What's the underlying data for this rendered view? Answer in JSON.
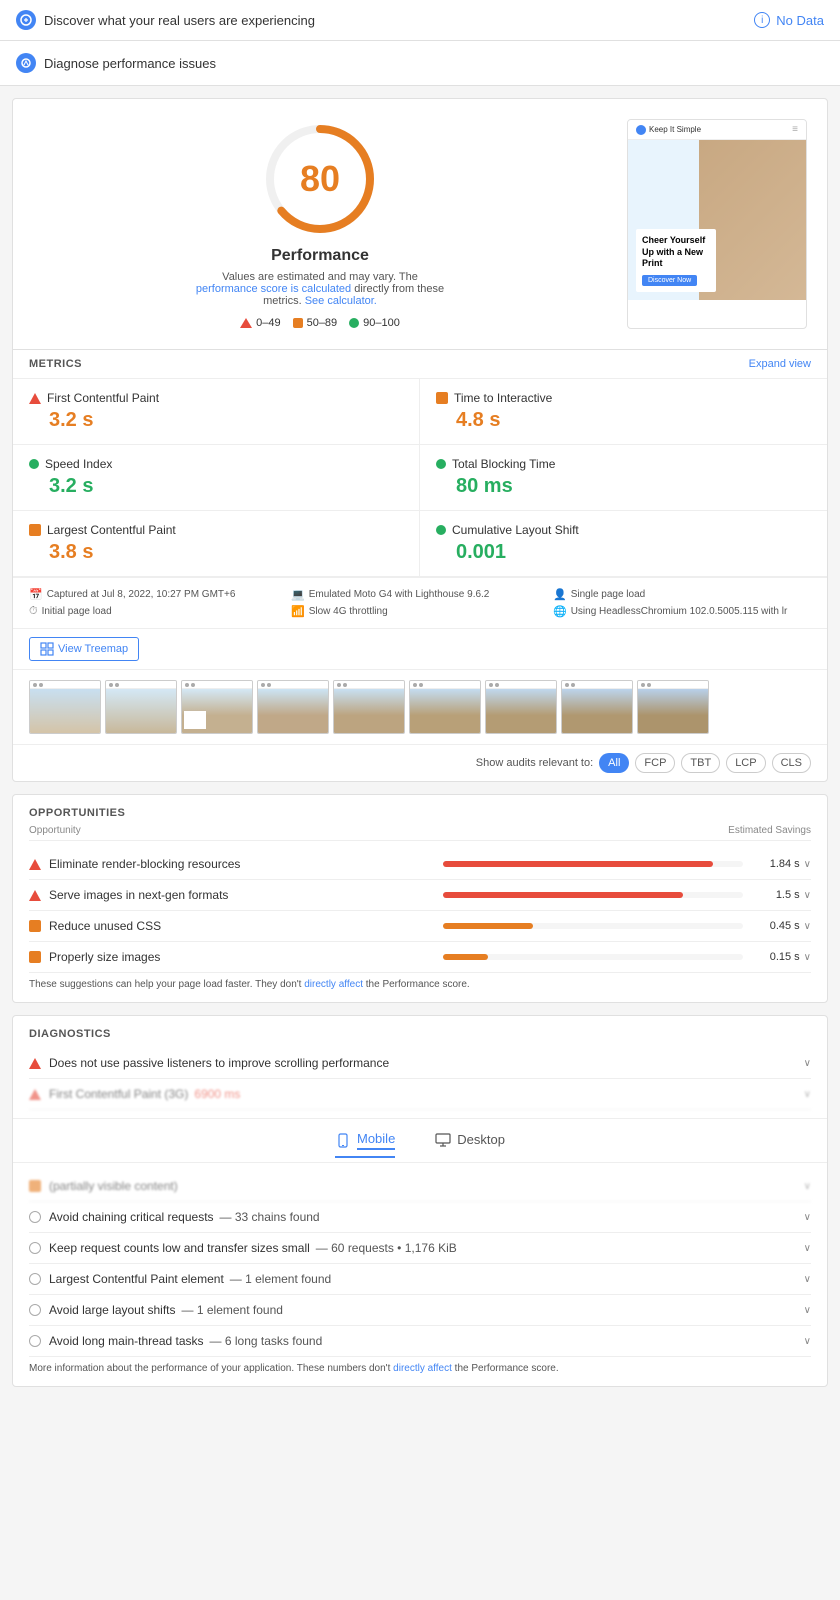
{
  "topBar": {
    "title": "Discover what your real users are experiencing",
    "noDataLabel": "No Data"
  },
  "sectionHeader": {
    "title": "Diagnose performance issues"
  },
  "score": {
    "value": "80",
    "label": "Performance",
    "description": "Values are estimated and may vary. The",
    "descriptionLink": "performance score is calculated",
    "descriptionMid": "directly from these metrics.",
    "calculatorLink": "See calculator.",
    "legend": [
      {
        "label": "0–49",
        "type": "triangle",
        "color": "#e74c3c"
      },
      {
        "label": "50–89",
        "type": "square",
        "color": "#e67e22"
      },
      {
        "label": "90–100",
        "type": "circle",
        "color": "#27ae60"
      }
    ]
  },
  "preview": {
    "siteName": "Keep It Simple",
    "headline": "Cheer Yourself Up with a New Print",
    "buttonLabel": "Discover Now"
  },
  "metrics": {
    "sectionLabel": "METRICS",
    "expandLabel": "Expand view",
    "items": [
      {
        "name": "First Contentful Paint",
        "value": "3.2 s",
        "color": "orange",
        "indicator": "red"
      },
      {
        "name": "Time to Interactive",
        "value": "4.8 s",
        "color": "orange",
        "indicator": "orange-sq"
      },
      {
        "name": "Speed Index",
        "value": "3.2 s",
        "color": "green",
        "indicator": "green-circle"
      },
      {
        "name": "Total Blocking Time",
        "value": "80 ms",
        "color": "green",
        "indicator": "green-circle"
      },
      {
        "name": "Largest Contentful Paint",
        "value": "3.8 s",
        "color": "orange",
        "indicator": "orange-sq"
      },
      {
        "name": "Cumulative Layout Shift",
        "value": "0.001",
        "color": "green",
        "indicator": "green-circle"
      }
    ]
  },
  "infoBar": [
    {
      "icon": "📅",
      "text": "Captured at Jul 8, 2022, 10:27 PM GMT+6"
    },
    {
      "icon": "💻",
      "text": "Emulated Moto G4 with Lighthouse 9.6.2"
    },
    {
      "icon": "👤",
      "text": "Single page load"
    },
    {
      "icon": "⏱",
      "text": "Initial page load"
    },
    {
      "icon": "📶",
      "text": "Slow 4G throttling"
    },
    {
      "icon": "🌐",
      "text": "Using HeadlessChromium 102.0.5005.115 with lr"
    }
  ],
  "treemapBtn": "View Treemap",
  "filmstrip": {
    "frames": 9
  },
  "auditFilters": {
    "label": "Show audits relevant to:",
    "buttons": [
      {
        "label": "All",
        "active": true
      },
      {
        "label": "FCP",
        "active": false
      },
      {
        "label": "TBT",
        "active": false
      },
      {
        "label": "LCP",
        "active": false
      },
      {
        "label": "CLS",
        "active": false
      }
    ]
  },
  "opportunities": {
    "sectionLabel": "OPPORTUNITIES",
    "opportunityHeader": "Opportunity",
    "savingsHeader": "Estimated Savings",
    "items": [
      {
        "name": "Eliminate render-blocking resources",
        "indicator": "red",
        "barWidth": "90%",
        "barColor": "red",
        "savings": "1.84 s"
      },
      {
        "name": "Serve images in next-gen formats",
        "indicator": "red",
        "barWidth": "80%",
        "barColor": "red",
        "savings": "1.5 s"
      },
      {
        "name": "Reduce unused CSS",
        "indicator": "orange-sq",
        "barWidth": "30%",
        "barColor": "orange",
        "savings": "0.45 s"
      },
      {
        "name": "Properly size images",
        "indicator": "orange-sq",
        "barWidth": "15%",
        "barColor": "orange",
        "savings": "0.15 s"
      }
    ],
    "note": "These suggestions can help your page load faster. They don't",
    "noteLink": "directly affect",
    "noteEnd": "the Performance score."
  },
  "diagnostics": {
    "sectionLabel": "DIAGNOSTICS",
    "items": [
      {
        "name": "Does not use passive listeners to improve scrolling performance",
        "indicator": "red",
        "detail": "",
        "chevron": true
      },
      {
        "name": "First Contentful Paint (3G)",
        "indicator": "red",
        "detail": "6900 ms",
        "chevron": true,
        "blurred": true
      },
      {
        "name": "(partially visible)",
        "indicator": "orange-sq",
        "detail": "...",
        "chevron": true,
        "blurred": true
      },
      {
        "name": "Avoid chaining critical requests",
        "indicator": "circle",
        "detail": "— 33 chains found",
        "chevron": true
      },
      {
        "name": "Keep request counts low and transfer sizes small",
        "indicator": "circle",
        "detail": "— 60 requests • 1,176 KiB",
        "chevron": true
      },
      {
        "name": "Largest Contentful Paint element",
        "indicator": "circle",
        "detail": "— 1 element found",
        "chevron": true
      },
      {
        "name": "Avoid large layout shifts",
        "indicator": "circle",
        "detail": "— 1 element found",
        "chevron": true
      },
      {
        "name": "Avoid long main-thread tasks",
        "indicator": "circle",
        "detail": "— 6 long tasks found",
        "chevron": true
      }
    ],
    "note": "More information about the performance of your application. These numbers don't",
    "noteLink": "directly affect",
    "noteEnd": "the Performance score."
  },
  "tabs": [
    {
      "label": "Mobile",
      "active": true,
      "icon": "mobile"
    },
    {
      "label": "Desktop",
      "active": false,
      "icon": "desktop"
    }
  ]
}
